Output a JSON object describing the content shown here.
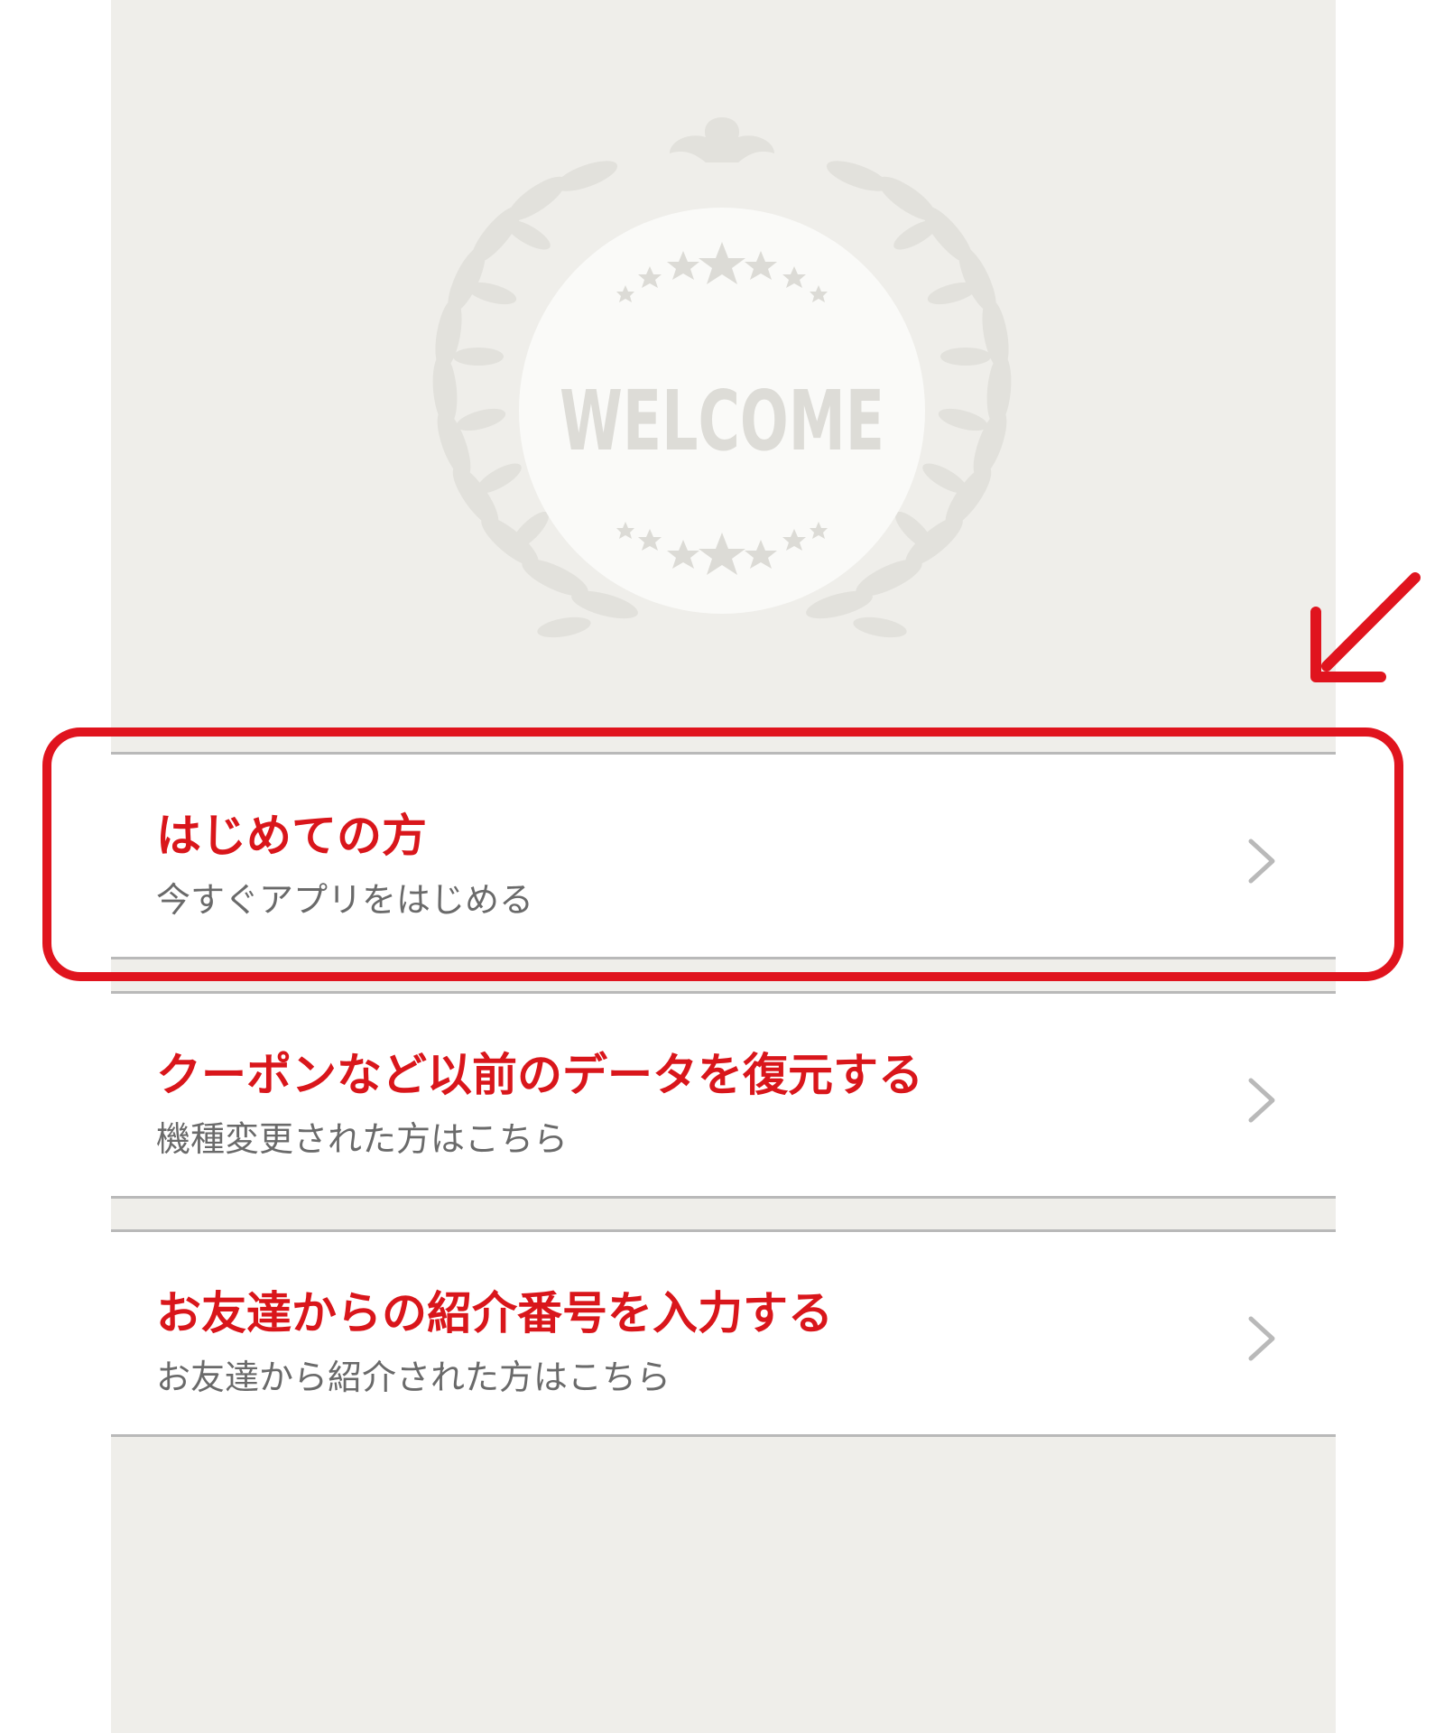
{
  "welcome": {
    "heading": "WELCOME"
  },
  "menu": {
    "items": [
      {
        "title": "はじめての方",
        "subtitle": "今すぐアプリをはじめる"
      },
      {
        "title": "クーポンなど以前のデータを復元する",
        "subtitle": "機種変更された方はこちら"
      },
      {
        "title": "お友達からの紹介番号を入力する",
        "subtitle": "お友達から紹介された方はこちら"
      }
    ],
    "chevron_icon": "chevron-right-icon"
  },
  "annotation": {
    "highlight_color": "#e0141e",
    "arrow_icon": "arrow-down-left-icon"
  },
  "colors": {
    "title_red": "#d9161b",
    "subtitle_gray": "#6a6a6a",
    "background": "#efeeea"
  }
}
